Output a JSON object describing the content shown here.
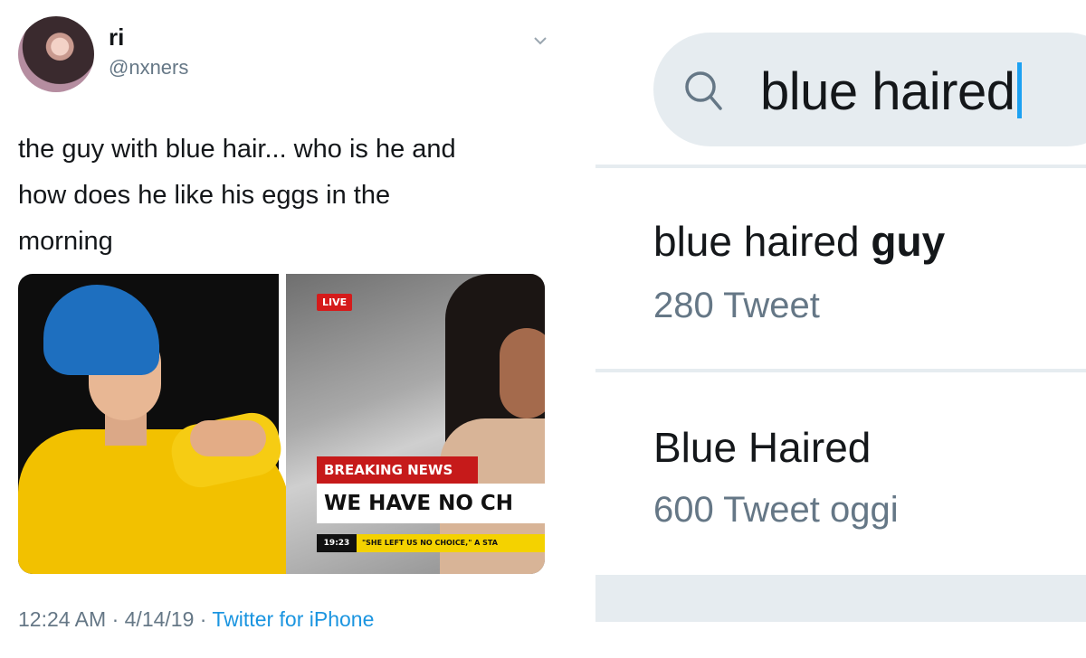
{
  "tweet": {
    "display_name": "ri",
    "handle": "@nxners",
    "text_lines": [
      "the guy with blue hair... who is he and",
      "how does he like his eggs in the",
      "morning"
    ],
    "media": {
      "news_overlay": {
        "live_label": "LIVE",
        "breaking_label": "BREAKING NEWS",
        "headline": "WE HAVE NO CH",
        "ticker_time": "19:23",
        "ticker_text": "\"SHE LEFT US NO CHOICE,\" A STA"
      }
    },
    "meta": {
      "time": "12:24 AM",
      "dot1": " · ",
      "date": "4/14/19",
      "dot2": " · ",
      "source": "Twitter for iPhone"
    }
  },
  "search": {
    "query": "blue haired",
    "results": [
      {
        "title_prefix": "blue haired ",
        "title_bold": "guy",
        "count": "280 Tweet"
      },
      {
        "title_prefix": "Blue Haired",
        "title_bold": "",
        "count": "600 Tweet oggi"
      }
    ]
  },
  "colors": {
    "link_blue": "#1b95e0",
    "meta_gray": "#657786",
    "search_bg": "#e6ecf0",
    "caret_blue": "#1da1f2"
  }
}
